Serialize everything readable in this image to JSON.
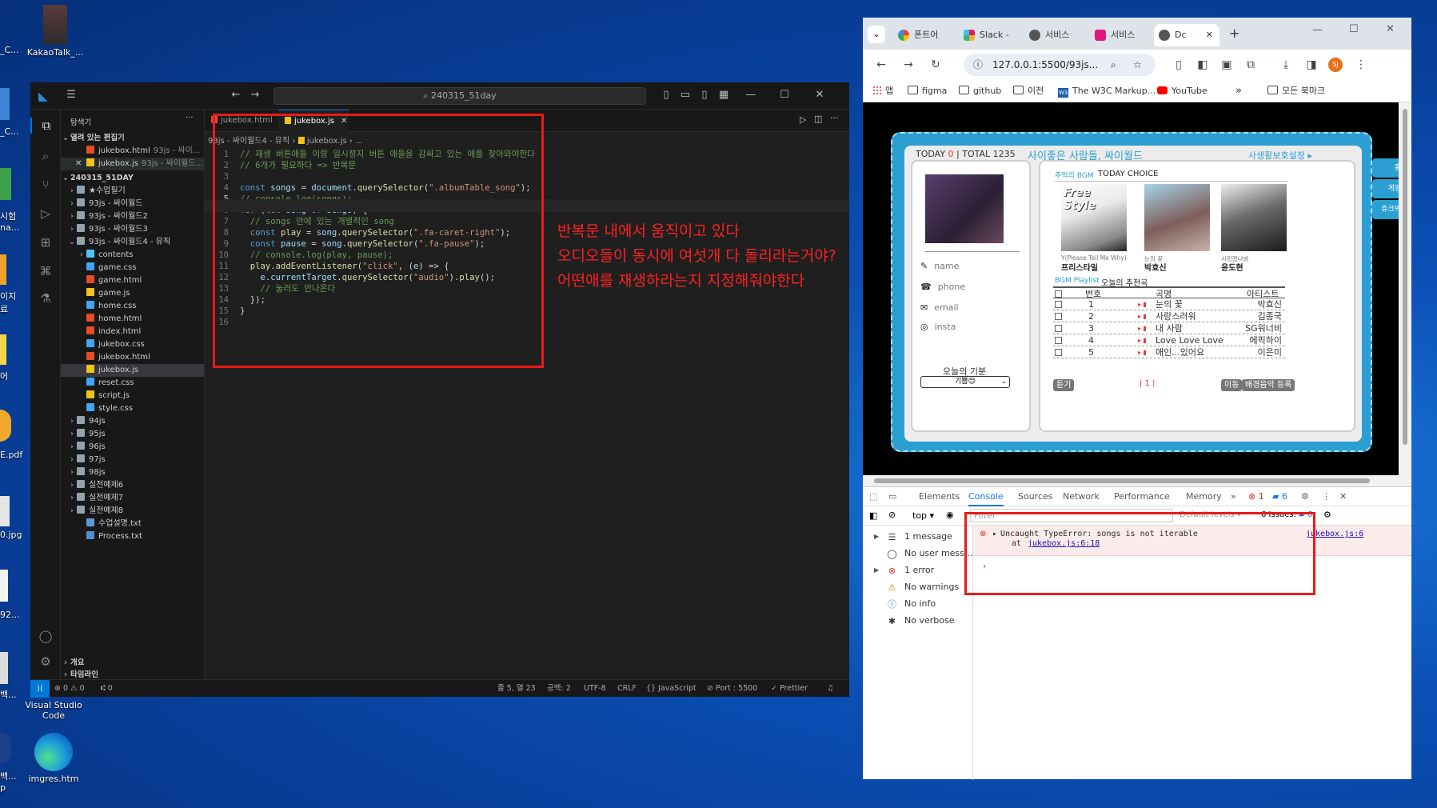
{
  "desktop": {
    "icons": [
      {
        "label": "KakaoTalk_..."
      },
      {
        "label": "Visual Studio Code"
      },
      {
        "label": "imgres.htm"
      }
    ],
    "left_cut_labels": [
      "_C...",
      "_C...",
      "시험\nna...",
      "이지\n료",
      "어",
      "E.pdf",
      "0.jpg",
      "92...",
      "백...",
      "백...\np"
    ]
  },
  "vscode": {
    "search_text": "240315_51day",
    "explorer_title": "탐색기",
    "open_editors_label": "열려 있는 편집기",
    "open_editors": [
      {
        "name": "jukebox.html",
        "path": "93js - 싸이..."
      },
      {
        "name": "jukebox.js",
        "path": "93js - 싸이월드..."
      }
    ],
    "root_folder": "240315_51DAY",
    "tree": [
      {
        "name": "★수업필기",
        "type": "folder"
      },
      {
        "name": "93js - 싸이월드",
        "type": "folder"
      },
      {
        "name": "93js - 싸이월드2",
        "type": "folder"
      },
      {
        "name": "93js - 싸이월드3",
        "type": "folder"
      },
      {
        "name": "93js - 싸이월드4 - 뮤직",
        "type": "folder-open"
      },
      {
        "name": "contents",
        "type": "subfolder"
      },
      {
        "name": "game.css",
        "type": "css"
      },
      {
        "name": "game.html",
        "type": "html"
      },
      {
        "name": "game.js",
        "type": "js"
      },
      {
        "name": "home.css",
        "type": "css"
      },
      {
        "name": "home.html",
        "type": "html"
      },
      {
        "name": "index.html",
        "type": "html"
      },
      {
        "name": "jukebox.css",
        "type": "css"
      },
      {
        "name": "jukebox.html",
        "type": "html"
      },
      {
        "name": "jukebox.js",
        "type": "js"
      },
      {
        "name": "reset.css",
        "type": "css"
      },
      {
        "name": "script.js",
        "type": "js"
      },
      {
        "name": "style.css",
        "type": "css"
      },
      {
        "name": "94js",
        "type": "folder"
      },
      {
        "name": "95js",
        "type": "folder"
      },
      {
        "name": "96js",
        "type": "folder"
      },
      {
        "name": "97js",
        "type": "folder"
      },
      {
        "name": "98js",
        "type": "folder"
      },
      {
        "name": "실전예제6",
        "type": "folder"
      },
      {
        "name": "실전예제7",
        "type": "folder"
      },
      {
        "name": "실전예제8",
        "type": "folder"
      },
      {
        "name": "수업설명.txt",
        "type": "txt"
      },
      {
        "name": "Process.txt",
        "type": "jstxt"
      }
    ],
    "outline_label": "개요",
    "timeline_label": "타임라인",
    "tabs": [
      {
        "label": "jukebox.html"
      },
      {
        "label": "jukebox.js"
      }
    ],
    "breadcrumb": {
      "folder": "93js - 싸이월드4 - 뮤직",
      "file": "jukebox.js",
      "rest": "..."
    },
    "code_lines": [
      "// 재생 버튼애들 이랑 일시정지 버튼 애들을 감싸고 있는 애를 찾아와야한다",
      "// 6개가 필요하다 => 반복문",
      "",
      "const songs = document.querySelector(\".albumTable_song\");",
      "// console.log(songs);",
      "for (let song of songs) {",
      "  // songs 안에 있는 개별적인 song",
      "  const play = song.querySelector(\".fa-caret-right\");",
      "  const pause = song.querySelector(\".fa-pause\");",
      "  // console.log(play, pause);",
      "  play.addEventListener(\"click\", (e) => {",
      "    e.currentTarget.querySelector(\"audio\").play();",
      "    // 눌러도 안나온다",
      "  });",
      "}",
      ""
    ],
    "status": {
      "errors": "0",
      "warnings": "0",
      "ports": "0",
      "position": "줄 5, 열 23",
      "spaces": "공백: 2",
      "encoding": "UTF-8",
      "eol": "CRLF",
      "language": "JavaScript",
      "port": "Port : 5500",
      "prettier": "Prettier"
    }
  },
  "annotation": [
    "반복문 내에서 움직이고 있다",
    "오디오들이 동시에 여섯개 다 돌리라는거야?",
    "어떤애를 재생하라는지 지정해줘야한다"
  ],
  "chrome": {
    "tabs": [
      {
        "label": "폰트어"
      },
      {
        "label": "Slack -"
      },
      {
        "label": "서비스"
      },
      {
        "label": "서비스"
      },
      {
        "label": "Dc"
      }
    ],
    "url": "127.0.0.1:5500/93js...",
    "bookmarks": [
      "앱",
      "figma",
      "github",
      "이전",
      "The W3C Markup...",
      "YouTube",
      "모든 북마크"
    ],
    "profile_initials": "SJ",
    "cyworld": {
      "today_label": "TODAY",
      "today_count": "0",
      "total": "TOTAL 1235",
      "title": "사이좋은 사람들, 싸이월드",
      "privacy": "사생활보호설정",
      "profile_fields": [
        "name",
        "phone",
        "email",
        "insta"
      ],
      "mood_label": "오늘의 기분",
      "mood_value": "기쁨😊",
      "bgm_label": "추억의 BGM",
      "today_choice": "TODAY CHOICE",
      "albums": [
        {
          "sub": "Y(Please Tell Me Why)",
          "artist": "프리스타일"
        },
        {
          "sub": "눈의 꽃",
          "artist": "박효신"
        },
        {
          "sub": "사랑했나봐",
          "artist": "윤도현"
        }
      ],
      "playlist_label": "BGM Playlist",
      "playlist_title": "오늘의 추천곡",
      "headers": [
        "번호",
        "곡명",
        "아티스트"
      ],
      "rows": [
        {
          "num": "1",
          "title": "눈의 꽃",
          "artist": "박효신"
        },
        {
          "num": "2",
          "title": "사랑스러워",
          "artist": "김종국"
        },
        {
          "num": "3",
          "title": "내 사람",
          "artist": "SG워너비"
        },
        {
          "num": "4",
          "title": "Love Love Love",
          "artist": "에픽하이"
        },
        {
          "num": "5",
          "title": "애인...있어요",
          "artist": "이은미"
        }
      ],
      "listen_btn": "듣기",
      "page": "| 1 |",
      "move_btn": "이동",
      "register_btn": "배경음악 등록",
      "side_tabs": [
        "홈",
        "게임",
        "쥬크박"
      ]
    },
    "devtools": {
      "tabs": [
        "Elements",
        "Console",
        "Sources",
        "Network",
        "Performance",
        "Memory"
      ],
      "error_count": "1",
      "issue_count": "6",
      "context": "top",
      "filter_placeholder": "Filter",
      "levels": "Default levels",
      "issues_label": "6 Issues:",
      "issues_badge": "6",
      "sidebar": [
        {
          "label": "1 message"
        },
        {
          "label": "No user mess..."
        },
        {
          "label": "1 error"
        },
        {
          "label": "No warnings"
        },
        {
          "label": "No info"
        },
        {
          "label": "No verbose"
        }
      ],
      "error_text": "Uncaught TypeError: songs is not iterable",
      "error_at": "at",
      "error_link": "jukebox.js:6:18",
      "error_source": "jukebox.js:6"
    }
  }
}
